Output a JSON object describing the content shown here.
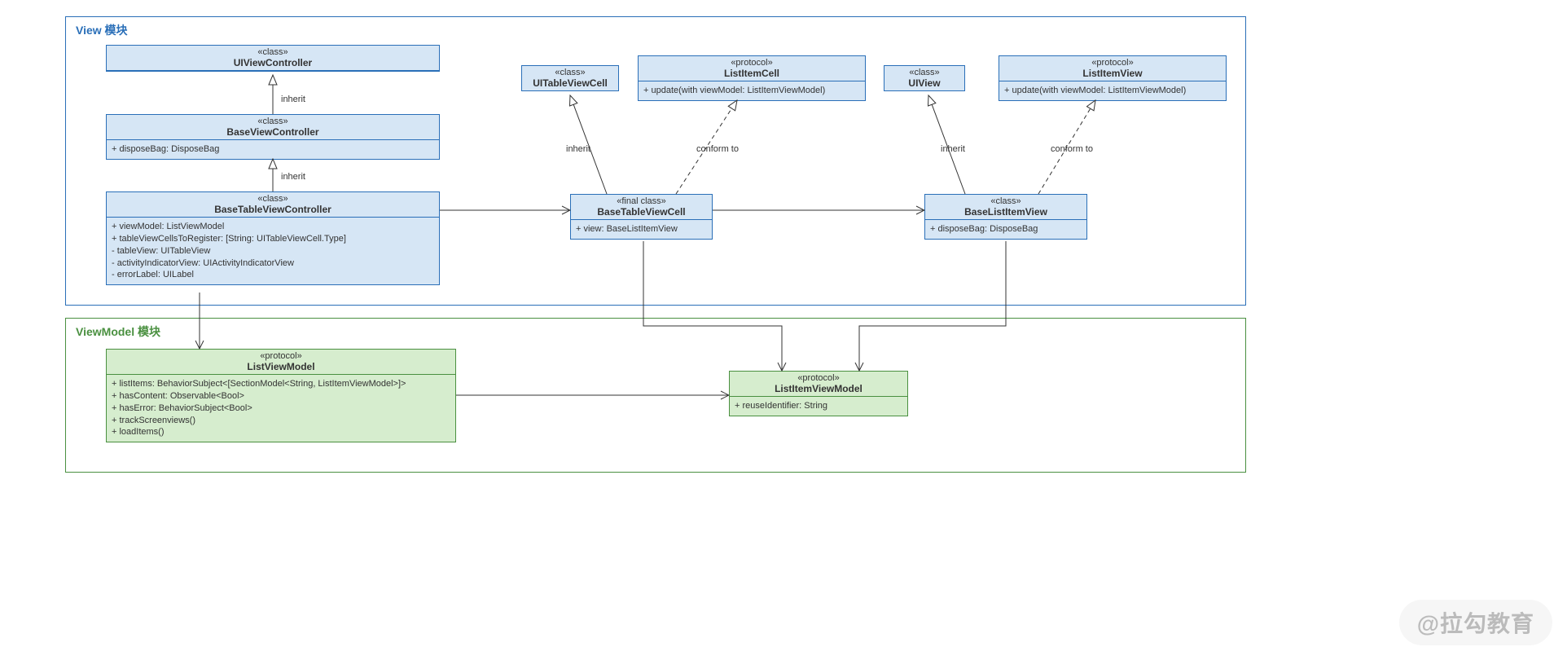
{
  "watermark": "@拉勾教育",
  "colors": {
    "view_module_border": "#2a6fb8",
    "view_fill": "#d6e6f5",
    "viewmodel_module_border": "#4a9040",
    "viewmodel_fill": "#d6edce"
  },
  "modules": {
    "view": {
      "title": "View 模块"
    },
    "viewmodel": {
      "title": "ViewModel 模块"
    }
  },
  "classes": {
    "UIViewController": {
      "stereotype": "«class»",
      "name": "UIViewController",
      "members": []
    },
    "BaseViewController": {
      "stereotype": "«class»",
      "name": "BaseViewController",
      "members": [
        "+ disposeBag: DisposeBag"
      ]
    },
    "BaseTableViewController": {
      "stereotype": "«class»",
      "name": "BaseTableViewController",
      "members": [
        "+ viewModel: ListViewModel",
        "+ tableViewCellsToRegister: [String: UITableViewCell.Type]",
        "- tableView: UITableView",
        "- activityIndicatorView: UIActivityIndicatorView",
        "- errorLabel: UILabel"
      ]
    },
    "UITableViewCell": {
      "stereotype": "«class»",
      "name": "UITableViewCell",
      "members": []
    },
    "BaseTableViewCell": {
      "stereotype": "«final class»",
      "name": "BaseTableViewCell",
      "members": [
        "+ view: BaseListItemView"
      ]
    },
    "ListItemCell": {
      "stereotype": "«protocol»",
      "name": "ListItemCell",
      "members": [
        "+ update(with viewModel: ListItemViewModel)"
      ]
    },
    "UIView": {
      "stereotype": "«class»",
      "name": "UIView",
      "members": []
    },
    "BaseListItemView": {
      "stereotype": "«class»",
      "name": "BaseListItemView",
      "members": [
        "+ disposeBag: DisposeBag"
      ]
    },
    "ListItemView": {
      "stereotype": "«protocol»",
      "name": "ListItemView",
      "members": [
        "+ update(with viewModel: ListItemViewModel)"
      ]
    },
    "ListViewModel": {
      "stereotype": "«protocol»",
      "name": "ListViewModel",
      "members": [
        "+ listItems: BehaviorSubject<[SectionModel<String, ListItemViewModel>]>",
        "+ hasContent: Observable<Bool>",
        "+ hasError: BehaviorSubject<Bool>",
        "+ trackScreenviews()",
        "+ loadItems()"
      ]
    },
    "ListItemViewModel": {
      "stereotype": "«protocol»",
      "name": "ListItemViewModel",
      "members": [
        "+ reuseIdentifier: String"
      ]
    }
  },
  "edges": {
    "inherit_UIViewController_BaseViewController": {
      "label": "inherit",
      "style": "solid",
      "from": "BaseViewController",
      "to": "UIViewController",
      "head": "hollow"
    },
    "inherit_BaseViewController_BaseTableViewController": {
      "label": "inherit",
      "style": "solid",
      "from": "BaseTableViewController",
      "to": "BaseViewController",
      "head": "hollow"
    },
    "inherit_UITableViewCell_BaseTableViewCell": {
      "label": "inherit",
      "style": "solid",
      "from": "BaseTableViewCell",
      "to": "UITableViewCell",
      "head": "hollow"
    },
    "conform_ListItemCell_BaseTableViewCell": {
      "label": "conform to",
      "style": "dashed",
      "from": "BaseTableViewCell",
      "to": "ListItemCell",
      "head": "hollow"
    },
    "inherit_UIView_BaseListItemView": {
      "label": "inherit",
      "style": "solid",
      "from": "BaseListItemView",
      "to": "UIView",
      "head": "hollow"
    },
    "conform_ListItemView_BaseListItemView": {
      "label": "conform to",
      "style": "dashed",
      "from": "BaseListItemView",
      "to": "ListItemView",
      "head": "hollow"
    },
    "assoc_BaseTableViewController_BaseTableViewCell": {
      "label": "",
      "style": "solid",
      "from": "BaseTableViewController",
      "to": "BaseTableViewCell",
      "head": "open"
    },
    "assoc_BaseTableViewCell_BaseListItemView": {
      "label": "",
      "style": "solid",
      "from": "BaseTableViewCell",
      "to": "BaseListItemView",
      "head": "open"
    },
    "assoc_BaseTableViewController_ListViewModel": {
      "label": "",
      "style": "solid",
      "from": "BaseTableViewController",
      "to": "ListViewModel",
      "head": "open"
    },
    "assoc_ListViewModel_ListItemViewModel": {
      "label": "",
      "style": "solid",
      "from": "ListViewModel",
      "to": "ListItemViewModel",
      "head": "open"
    },
    "assoc_BaseTableViewCell_ListItemViewModel": {
      "label": "",
      "style": "solid",
      "from": "BaseTableViewCell",
      "to": "ListItemViewModel",
      "head": "open"
    },
    "assoc_BaseListItemView_ListItemViewModel": {
      "label": "",
      "style": "solid",
      "from": "BaseListItemView",
      "to": "ListItemViewModel",
      "head": "open"
    }
  }
}
